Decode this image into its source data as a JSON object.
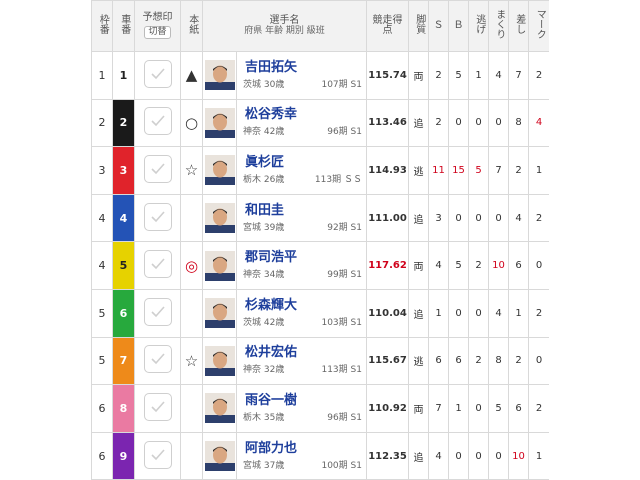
{
  "header": {
    "waku": "枠番",
    "car": "車番",
    "yoso": "予想印",
    "kirikae": "切替",
    "honshi": "本紙",
    "name_main": "選手名",
    "name_sub1": "府県 年齢 期別 級班",
    "score": "競走得点",
    "kyakushitsu": "脚質",
    "s": "Ｓ",
    "b": "Ｂ",
    "nige": "逃げ",
    "makuri": "まくり",
    "sashi": "差し",
    "mark": "マーク"
  },
  "colors": {
    "car_1": "#ffffff",
    "car_2": "#1a1a1a",
    "car_3": "#e0232b",
    "car_4": "#2453b6",
    "car_5": "#e6d200",
    "car_6": "#27a93d",
    "car_7": "#ee8a1a",
    "car_8": "#ea7aa2",
    "car_9": "#7b25b0",
    "name": "#1e3f9c",
    "highlight": "#d0021b"
  },
  "rows": [
    {
      "waku": "1",
      "car": "1",
      "honshi": "▲",
      "name": "吉田拓矢",
      "pref": "茨城",
      "age": "30歳",
      "ki": "107期",
      "cls": "S1",
      "score": "115.74",
      "kyaku": "両",
      "s": "2",
      "b": "5",
      "nige": "1",
      "makuri": "4",
      "sashi": "7",
      "mark": "2"
    },
    {
      "waku": "2",
      "car": "2",
      "honshi": "○",
      "name": "松谷秀幸",
      "pref": "神奈",
      "age": "42歳",
      "ki": "96期",
      "cls": "S1",
      "score": "113.46",
      "kyaku": "追",
      "s": "2",
      "b": "0",
      "nige": "0",
      "makuri": "0",
      "sashi": "8",
      "mark": "4"
    },
    {
      "waku": "3",
      "car": "3",
      "honshi": "☆",
      "name": "眞杉匠",
      "pref": "栃木",
      "age": "26歳",
      "ki": "113期",
      "cls": "ＳＳ",
      "score": "114.93",
      "kyaku": "逃",
      "s": "11",
      "b": "15",
      "nige": "5",
      "makuri": "7",
      "sashi": "2",
      "mark": "1"
    },
    {
      "waku": "4",
      "car": "4",
      "honshi": "",
      "name": "和田圭",
      "pref": "宮城",
      "age": "39歳",
      "ki": "92期",
      "cls": "S1",
      "score": "111.00",
      "kyaku": "追",
      "s": "3",
      "b": "0",
      "nige": "0",
      "makuri": "0",
      "sashi": "4",
      "mark": "2"
    },
    {
      "waku": "4",
      "car": "5",
      "honshi": "◎",
      "name": "郡司浩平",
      "pref": "神奈",
      "age": "34歳",
      "ki": "99期",
      "cls": "S1",
      "score": "117.62",
      "kyaku": "両",
      "s": "4",
      "b": "5",
      "nige": "2",
      "makuri": "10",
      "sashi": "6",
      "mark": "0"
    },
    {
      "waku": "5",
      "car": "6",
      "honshi": "",
      "name": "杉森輝大",
      "pref": "茨城",
      "age": "42歳",
      "ki": "103期",
      "cls": "S1",
      "score": "110.04",
      "kyaku": "追",
      "s": "1",
      "b": "0",
      "nige": "0",
      "makuri": "4",
      "sashi": "1",
      "mark": "2"
    },
    {
      "waku": "5",
      "car": "7",
      "honshi": "☆",
      "name": "松井宏佑",
      "pref": "神奈",
      "age": "32歳",
      "ki": "113期",
      "cls": "S1",
      "score": "115.67",
      "kyaku": "逃",
      "s": "6",
      "b": "6",
      "nige": "2",
      "makuri": "8",
      "sashi": "2",
      "mark": "0"
    },
    {
      "waku": "6",
      "car": "8",
      "honshi": "",
      "name": "雨谷一樹",
      "pref": "栃木",
      "age": "35歳",
      "ki": "96期",
      "cls": "S1",
      "score": "110.92",
      "kyaku": "両",
      "s": "7",
      "b": "1",
      "nige": "0",
      "makuri": "5",
      "sashi": "6",
      "mark": "2"
    },
    {
      "waku": "6",
      "car": "9",
      "honshi": "",
      "name": "阿部力也",
      "pref": "宮城",
      "age": "37歳",
      "ki": "100期",
      "cls": "S1",
      "score": "112.35",
      "kyaku": "追",
      "s": "4",
      "b": "0",
      "nige": "0",
      "makuri": "0",
      "sashi": "10",
      "mark": "1"
    }
  ],
  "highlights": {
    "score_row": 4,
    "s_row": 2,
    "b_row": 2,
    "nige_row": 2,
    "makuri_row": 4,
    "sashi_row": 8,
    "mark_row": 1
  }
}
